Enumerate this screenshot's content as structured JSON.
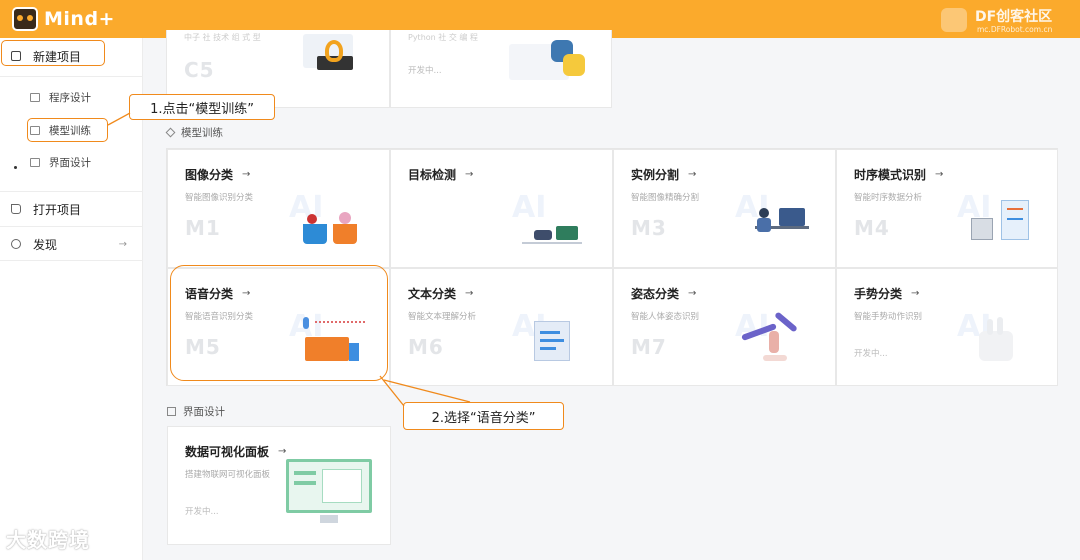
{
  "app": {
    "title": "Mind+",
    "brand_name": "DF创客社区",
    "brand_url": "mc.DFRobot.com.cn"
  },
  "sidebar": {
    "new_project": "新建项目",
    "sub_items": [
      {
        "label": "程序设计",
        "icon": "code-icon"
      },
      {
        "label": "模型训练",
        "icon": "cube-icon"
      },
      {
        "label": "界面设计",
        "icon": "window-icon"
      }
    ],
    "open_project": "打开项目",
    "discover": "发现",
    "discover_arrow": "→"
  },
  "top_partial": {
    "left_title": "中子 社 技术 组 式 型",
    "left_code": "C5",
    "right_title": "Python 社 交 编 程",
    "right_soon": "开发中..."
  },
  "sections": {
    "model_training": "模型训练",
    "ui_design": "界面设计"
  },
  "model_cards": [
    {
      "title": "图像分类",
      "desc": "智能图像识别分类",
      "code": "M1"
    },
    {
      "title": "目标检测",
      "desc": "",
      "code": ""
    },
    {
      "title": "实例分割",
      "desc": "智能图像精确分割",
      "code": "M3"
    },
    {
      "title": "时序模式识别",
      "desc": "智能时序数据分析",
      "code": "M4"
    },
    {
      "title": "语音分类",
      "desc": "智能语音识别分类",
      "code": "M5"
    },
    {
      "title": "文本分类",
      "desc": "智能文本理解分析",
      "code": "M6"
    },
    {
      "title": "姿态分类",
      "desc": "智能人体姿态识别",
      "code": "M7"
    },
    {
      "title": "手势分类",
      "desc": "智能手势动作识别",
      "code": "",
      "soon": "开发中..."
    }
  ],
  "ui_cards": [
    {
      "title": "数据可视化面板",
      "desc": "搭建物联网可视化面板",
      "soon": "开发中..."
    }
  ],
  "annotations": {
    "step1": "1.点击“模型训练”",
    "step2": "2.选择“语音分类”"
  },
  "watermark": "大数跨境",
  "colors": {
    "topbar": "#fbaa2c",
    "highlight": "#f08a1c"
  }
}
